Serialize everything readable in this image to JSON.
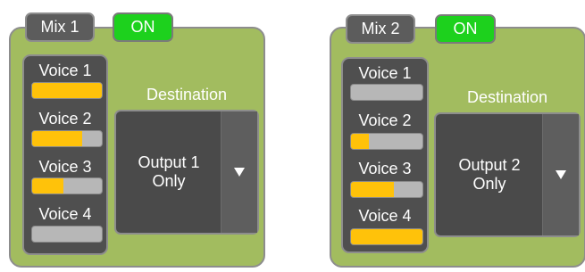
{
  "mixes": [
    {
      "title": "Mix 1",
      "toggle": "ON",
      "voices": [
        {
          "label": "Voice 1",
          "level": 1.0
        },
        {
          "label": "Voice 2",
          "level": 0.72
        },
        {
          "label": "Voice 3",
          "level": 0.45
        },
        {
          "label": "Voice 4",
          "level": 0.0
        }
      ],
      "destination_label": "Destination",
      "destination_value_line1": "Output 1",
      "destination_value_line2": "Only"
    },
    {
      "title": "Mix 2",
      "toggle": "ON",
      "voices": [
        {
          "label": "Voice 1",
          "level": 0.0
        },
        {
          "label": "Voice 2",
          "level": 0.25
        },
        {
          "label": "Voice 3",
          "level": 0.6
        },
        {
          "label": "Voice 4",
          "level": 1.0
        }
      ],
      "destination_label": "Destination",
      "destination_value_line1": "Output 2",
      "destination_value_line2": "Only"
    }
  ],
  "colors": {
    "panel_bg": "#a2bc5f",
    "dark_bg": "#4f4f4f",
    "on_green": "#1dd11d",
    "level_fill": "#ffc20a",
    "level_track": "#b7b7b7"
  },
  "icons": {
    "dropdown": "triangle-down-icon"
  }
}
